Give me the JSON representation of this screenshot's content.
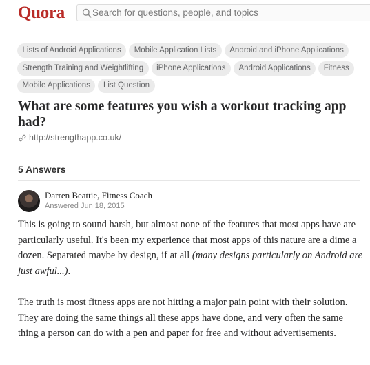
{
  "header": {
    "logo": "Quora",
    "search_placeholder": "Search for questions, people, and topics"
  },
  "topics": [
    [
      "Lists of Android Applications",
      "Mobile Application Lists",
      "Android and iPhone Applications"
    ],
    [
      "Strength Training and Weightlifting",
      "iPhone Applications",
      "Android Applications",
      "Fitness"
    ],
    [
      "Mobile Applications",
      "List Question"
    ]
  ],
  "question": {
    "title": "What are some features you wish a workout tracking app had?",
    "link": "http://strengthapp.co.uk/"
  },
  "answers": {
    "count_label": "5 Answers",
    "first": {
      "author": "Darren Beattie, Fitness Coach",
      "date": "Answered Jun 18, 2015",
      "para1_text": "This is going to sound harsh, but almost none of the features that most apps have are particularly useful. It's been my experience that most apps of this nature are a dime a dozen. Separated maybe by design, if at all ",
      "para1_italic": "(many designs particularly on Android are just awful...)",
      "para1_end": ".",
      "para2": "The truth is most fitness apps are not hitting a major pain point with their solution. They are doing the same things all these apps have done, and very often the same thing a person can do with a pen and paper for free and without advertisements."
    }
  },
  "colors": {
    "brand": "#b92b27",
    "topic_bg": "#ebebeb"
  },
  "icons": {
    "search": "search-icon",
    "link": "link-icon",
    "avatar": "avatar"
  }
}
